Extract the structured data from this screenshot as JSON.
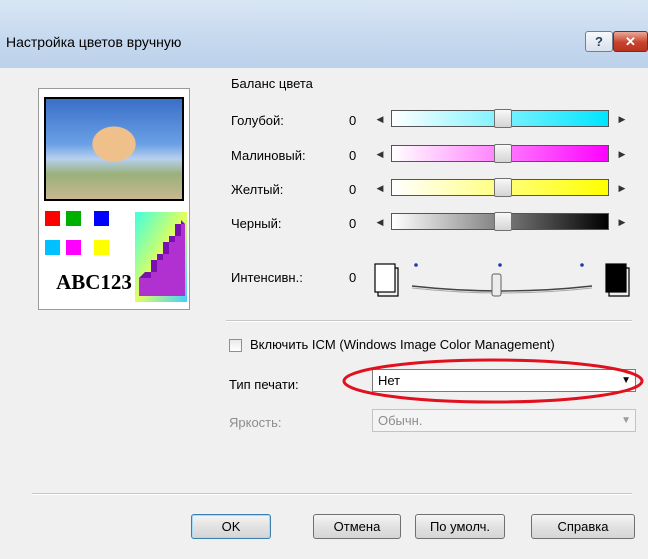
{
  "window": {
    "title": "Настройка цветов вручную",
    "help_glyph": "?",
    "close_glyph": "✕"
  },
  "preview": {
    "sample_text": "ABC123",
    "swatches": [
      "#ff0000",
      "#00b000",
      "#0000ff",
      "#00c0ff",
      "#ff00ff",
      "#ffff00"
    ]
  },
  "color_balance": {
    "title": "Баланс цвета",
    "rows": [
      {
        "label": "Голубой:",
        "value": "0",
        "color": "#00e5ff"
      },
      {
        "label": "Малиновый:",
        "value": "0",
        "color": "#ff00ff"
      },
      {
        "label": "Желтый:",
        "value": "0",
        "color": "#ffff00"
      },
      {
        "label": "Черный:",
        "value": "0",
        "color": "#000000"
      }
    ]
  },
  "intensity": {
    "label": "Интенсивн.:",
    "value": "0"
  },
  "icm": {
    "label": "Включить ICM (Windows Image Color Management)",
    "checked": false
  },
  "print_type": {
    "label": "Тип печати:",
    "value": "Нет"
  },
  "brightness": {
    "label": "Яркость:",
    "value": "Обычн."
  },
  "buttons": {
    "ok": "OK",
    "cancel": "Отмена",
    "default": "По умолч.",
    "help": "Справка"
  },
  "colors": {
    "highlight_ellipse": "#e0101e",
    "title_bar": "#c5d8ee"
  }
}
